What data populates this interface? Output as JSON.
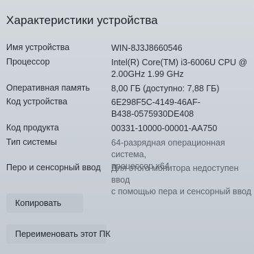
{
  "section": {
    "title": "Характеристики устройства"
  },
  "specs": [
    {
      "label": "Имя устройства",
      "value_lines": [
        "WIN-8J3J8660546"
      ]
    },
    {
      "label": "Процессор",
      "value_lines": [
        "Intel(R) Core(TM) i3-6006U CPU @",
        "2.00GHz   1.99 GHz"
      ]
    },
    {
      "label": "Оперативная память",
      "value_lines": [
        "8,00 ГБ (доступно: 7,88 ГБ)"
      ]
    },
    {
      "label": "Код устройства",
      "value_lines": [
        "6E298F5C-4149-46AF-",
        "B438-0575930DE408"
      ]
    },
    {
      "label": "Код продукта",
      "value_lines": [
        "00331-10000-00001-AA750"
      ]
    },
    {
      "label": "Тип системы",
      "value_lines": [
        "64-разрядная операционная система,",
        "процессор x64"
      ]
    },
    {
      "label": "Перо и сенсорный ввод",
      "value_lines": [
        "Для этого монитора недоступен ввод",
        "с помощью пера и сенсорный ввод"
      ]
    }
  ],
  "actions": {
    "copy_label": "Копировать",
    "rename_label": "Переименовать этот ПК"
  }
}
